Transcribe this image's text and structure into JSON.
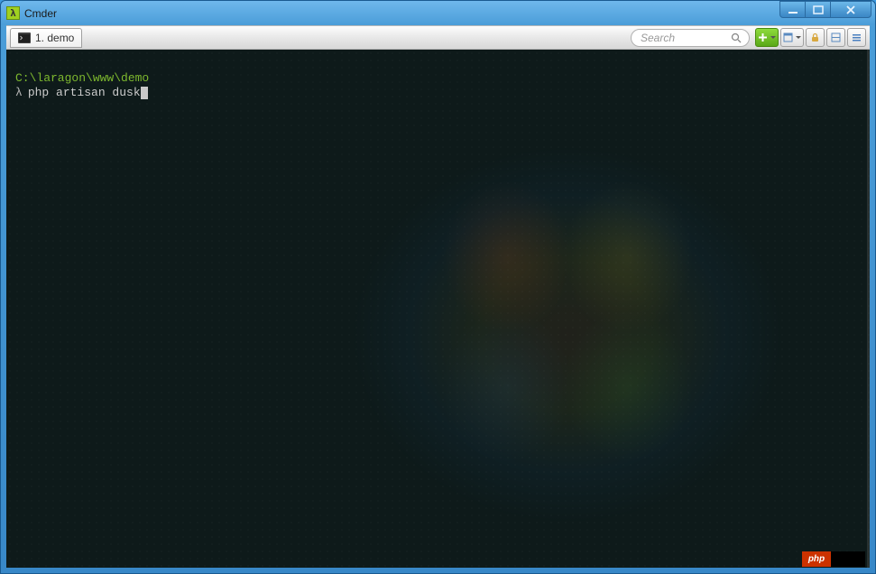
{
  "window": {
    "title": "Cmder",
    "icon_char": "λ"
  },
  "tab": {
    "label": "1. demo"
  },
  "search": {
    "placeholder": "Search"
  },
  "terminal": {
    "cwd": "C:\\laragon\\www\\demo",
    "prompt": "λ",
    "command": "php artisan dusk"
  },
  "badge": {
    "text": "php"
  }
}
